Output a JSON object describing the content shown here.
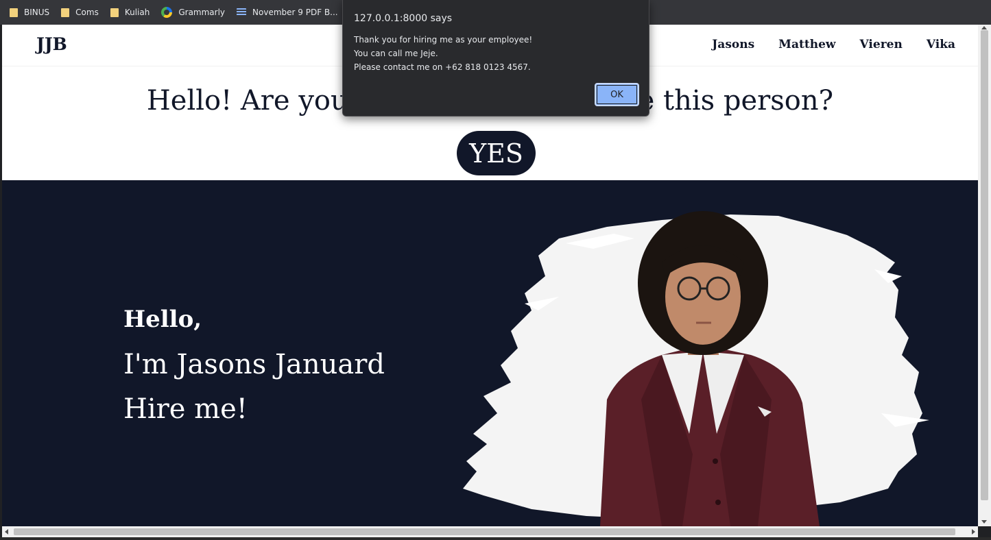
{
  "bookmarks": [
    {
      "label": "BINUS",
      "icon": "folder-icon"
    },
    {
      "label": "Coms",
      "icon": "folder-icon"
    },
    {
      "label": "Kuliah",
      "icon": "folder-icon"
    },
    {
      "label": "Grammarly",
      "icon": "grammarly-icon"
    },
    {
      "label": "November 9 PDF B...",
      "icon": "layers-icon"
    }
  ],
  "site": {
    "logo": "JJB",
    "nav": [
      "Jasons",
      "Matthew",
      "Vieren",
      "Vika"
    ],
    "question": "Hello! Are you sure you want to hire this person?",
    "yes_label": "YES",
    "hero": {
      "greeting": "Hello,",
      "name_line": "I'm Jasons Januard",
      "cta": "Hire me!"
    }
  },
  "alert": {
    "title": "127.0.0.1:8000 says",
    "lines": [
      "Thank you for hiring me as your employee!",
      "You can call me Jeje.",
      "Please contact me on +62 818 0123 4567."
    ],
    "ok_label": "OK"
  },
  "colors": {
    "navy": "#111729",
    "maroon_jacket": "#5a1f28",
    "dialog_bg": "#292a2d",
    "ok_button": "#8ab4f8"
  }
}
